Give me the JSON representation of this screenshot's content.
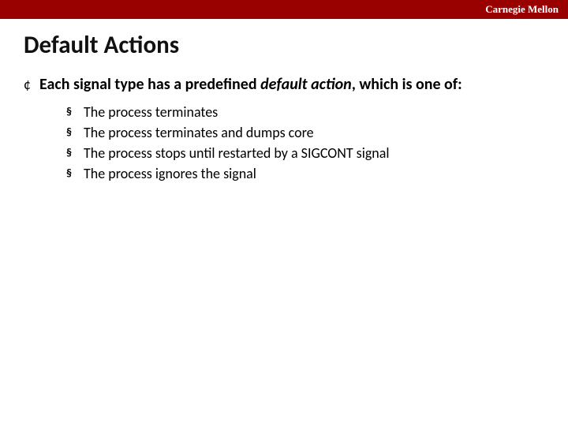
{
  "header": {
    "brand": "Carnegie Mellon"
  },
  "title": "Default Actions",
  "bullets": {
    "lvl1_marker": "¢",
    "lvl2_marker": "§"
  },
  "body": {
    "intro": {
      "pre": "Each signal type has a predefined ",
      "em": "default action",
      "post": ", which is one of:"
    },
    "items": [
      "The process terminates",
      "The process terminates and dumps core",
      "The process stops until restarted by a SIGCONT signal",
      "The process ignores the signal"
    ]
  }
}
